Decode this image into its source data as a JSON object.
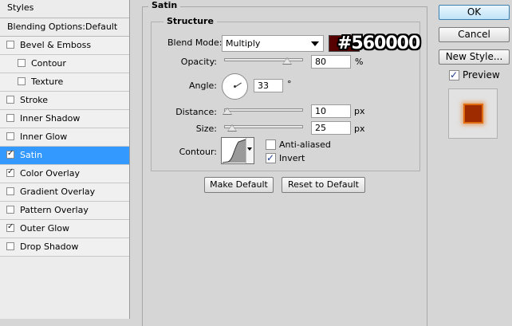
{
  "styles_panel": {
    "header": "Styles",
    "blending_options": "Blending Options:Default",
    "items": [
      {
        "label": "Bevel & Emboss",
        "checked": false
      },
      {
        "label": "Contour",
        "checked": false
      },
      {
        "label": "Texture",
        "checked": false
      },
      {
        "label": "Stroke",
        "checked": false
      },
      {
        "label": "Inner Shadow",
        "checked": false
      },
      {
        "label": "Inner Glow",
        "checked": false
      },
      {
        "label": "Satin",
        "checked": true
      },
      {
        "label": "Color Overlay",
        "checked": true
      },
      {
        "label": "Gradient Overlay",
        "checked": false
      },
      {
        "label": "Pattern Overlay",
        "checked": false
      },
      {
        "label": "Outer Glow",
        "checked": true
      },
      {
        "label": "Drop Shadow",
        "checked": false
      }
    ]
  },
  "satin": {
    "group_title": "Satin",
    "structure_title": "Structure",
    "blend_mode_label": "Blend Mode:",
    "blend_mode_value": "Multiply",
    "color": "#560000",
    "color_annotation": "#560000",
    "opacity_label": "Opacity:",
    "opacity_value": "80",
    "opacity_fraction": 0.8,
    "percent_unit": "%",
    "angle_label": "Angle:",
    "angle_value": "33",
    "degree_unit": "°",
    "distance_label": "Distance:",
    "distance_value": "10",
    "distance_fraction": 0.04,
    "size_label": "Size:",
    "size_value": "25",
    "size_fraction": 0.1,
    "px_unit": "px",
    "contour_label": "Contour:",
    "anti_aliased_label": "Anti-aliased",
    "anti_aliased_checked": false,
    "invert_label": "Invert",
    "invert_checked": true,
    "make_default": "Make Default",
    "reset_default": "Reset to Default"
  },
  "right": {
    "ok": "OK",
    "cancel": "Cancel",
    "new_style": "New Style...",
    "preview_label": "Preview",
    "preview_checked": true
  }
}
